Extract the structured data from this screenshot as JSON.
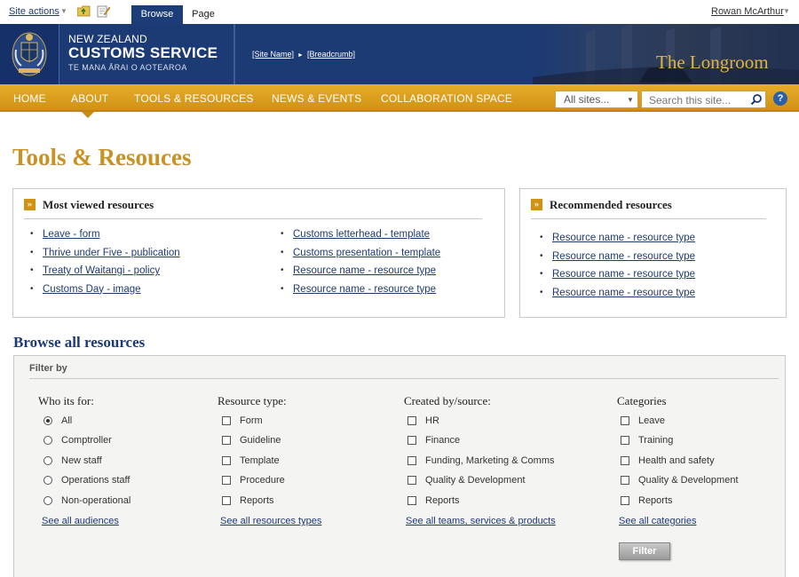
{
  "ribbon": {
    "site_actions": "Site actions",
    "tabs": [
      "Browse",
      "Page"
    ],
    "user": "Rowan McArthur"
  },
  "brand": {
    "line1": "NEW ZEALAND",
    "line2": "CUSTOMS SERVICE",
    "line3": "TE MANA ĀRAI O AOTEAROA",
    "crumb_site": "[Site Name]",
    "crumb_page": "[Breadcrumb]",
    "site_title": "The Longroom"
  },
  "nav": {
    "items": [
      "HOME",
      "ABOUT",
      "TOOLS & RESOURCES",
      "NEWS & EVENTS",
      "COLLABORATION SPACE"
    ],
    "scope_select": "All sites...",
    "search_placeholder": "Search this site...",
    "help_label": "?"
  },
  "page": {
    "title": "Tools & Resouces"
  },
  "most_viewed": {
    "heading": "Most viewed resources",
    "col1": [
      "Leave - form",
      "Thrive under Five - publication",
      "Treaty of Waitangi - policy",
      "Customs Day - image"
    ],
    "col2": [
      "Customs letterhead - template",
      "Customs presentation - template",
      "Resource name - resource type",
      "Resource name - resource type"
    ]
  },
  "recommended": {
    "heading": "Recommended resources",
    "items": [
      "Resource name - resource type",
      "Resource name - resource type",
      "Resource name - resource type",
      "Resource name - resource type"
    ]
  },
  "browse": {
    "title": "Browse all resources",
    "filter_by": "Filter by",
    "columns": [
      {
        "heading": "Who its for:",
        "control": "radio",
        "options": [
          "All",
          "Comptroller",
          "New staff",
          "Operations staff",
          "Non-operational"
        ],
        "selected": "All",
        "see_all": "See all audiences"
      },
      {
        "heading": "Resource type:",
        "control": "checkbox",
        "options": [
          "Form",
          "Guideline",
          "Template",
          "Procedure",
          "Reports"
        ],
        "see_all": "See all resources types"
      },
      {
        "heading": "Created by/source:",
        "control": "checkbox",
        "options": [
          "HR",
          "Finance",
          "Funding, Marketing & Comms",
          "Quality & Development",
          "Reports"
        ],
        "see_all": "See all teams, services & products"
      },
      {
        "heading": "Categories",
        "control": "checkbox",
        "options": [
          "Leave",
          "Training",
          "Health and safety",
          "Quality & Development",
          "Reports"
        ],
        "see_all": "See all categories"
      }
    ],
    "filter_button": "Filter"
  },
  "colors": {
    "navy": "#1c3a73",
    "gold": "#d19214",
    "title_gold": "#c99225",
    "link": "#1f3a6e"
  },
  "icons": [
    "folder-up-icon",
    "edit-page-icon",
    "crest-icon",
    "search-icon",
    "help-icon",
    "raquo-icon"
  ]
}
